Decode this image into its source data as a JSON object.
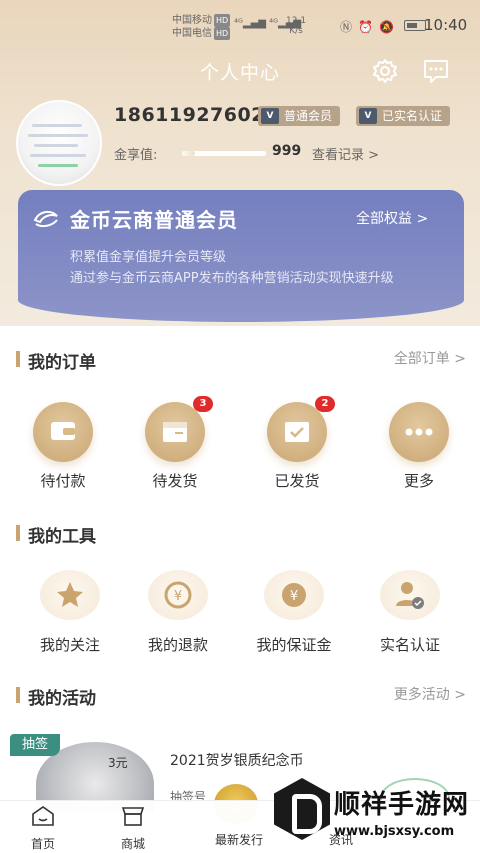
{
  "status_bar": {
    "carrier1": "中国移动",
    "carrier2": "中国电信",
    "hd": "HD",
    "speed_value": "12.1",
    "speed_unit": "K/s",
    "time": "10:40"
  },
  "header": {
    "title": "个人中心"
  },
  "profile": {
    "phone": "18611927602",
    "badge_member": "普通会员",
    "badge_verified": "已实名认证",
    "jinxiang_label": "金享值:",
    "jinxiang_value": "999",
    "view_records": "查看记录 >",
    "progress_fraction": 0.15
  },
  "member_card": {
    "title": "金币云商普通会员",
    "all_benefits": "全部权益 >",
    "desc1": "积累值金享值提升会员等级",
    "desc2": "通过参与金币云商APP发布的各种营销活动实现快速升级"
  },
  "orders": {
    "title": "我的订单",
    "more": "全部订单 >",
    "items": [
      {
        "label": "待付款",
        "icon": "wallet-icon",
        "badge": ""
      },
      {
        "label": "待发货",
        "icon": "package-icon",
        "badge": "3"
      },
      {
        "label": "已发货",
        "icon": "shipped-icon",
        "badge": "2"
      },
      {
        "label": "更多",
        "icon": "more-dots-icon",
        "badge": ""
      }
    ]
  },
  "tools": {
    "title": "我的工具",
    "items": [
      {
        "label": "我的关注",
        "icon": "star-icon"
      },
      {
        "label": "我的退款",
        "icon": "refund-icon"
      },
      {
        "label": "我的保证金",
        "icon": "yen-icon"
      },
      {
        "label": "实名认证",
        "icon": "user-verified-icon"
      }
    ]
  },
  "activities": {
    "title": "我的活动",
    "more": "更多活动 >",
    "tag": "抽签",
    "coin_face": "3元",
    "name": "2021贺岁银质纪念币",
    "draw_label": "抽签号"
  },
  "bottom_nav": [
    {
      "label": "首页",
      "icon": "home-icon"
    },
    {
      "label": "商城",
      "icon": "shop-icon"
    },
    {
      "label": "最新发行",
      "icon": "new-release-icon"
    },
    {
      "label": "资讯",
      "icon": "news-icon"
    }
  ],
  "watermark": {
    "title": "顺祥手游网",
    "url": "www.bjsxsy.com"
  }
}
